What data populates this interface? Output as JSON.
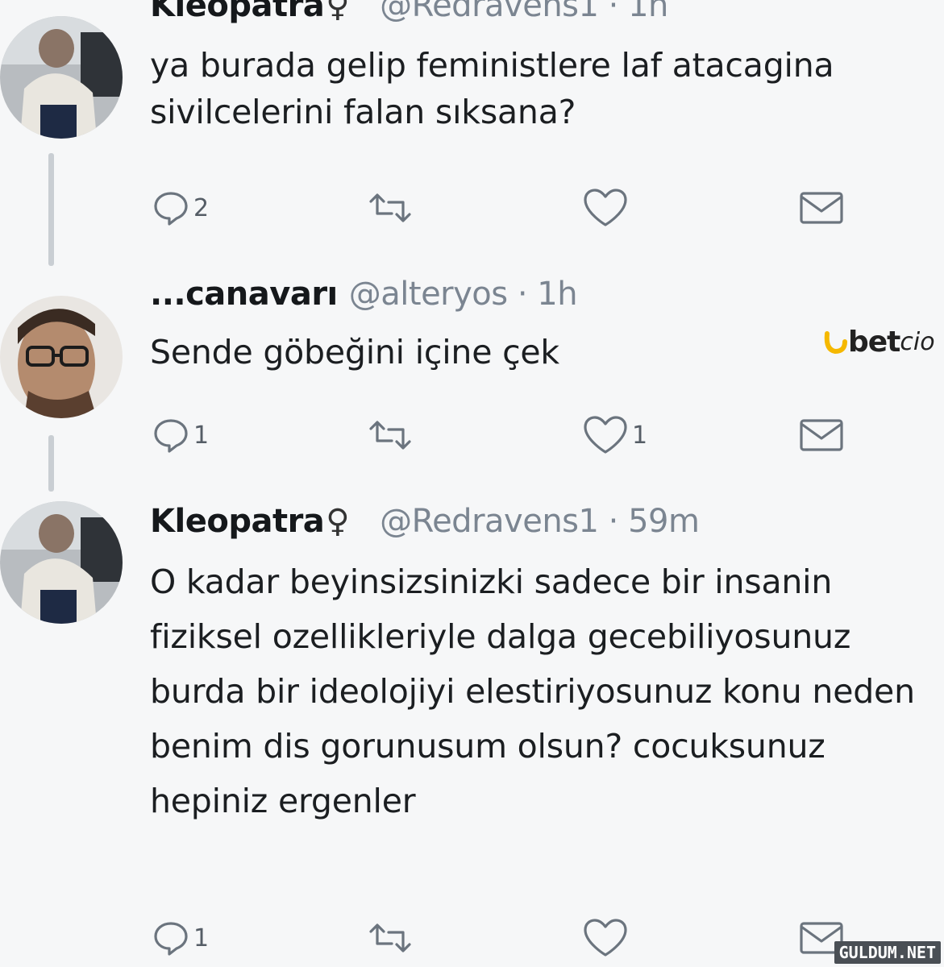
{
  "tweets": [
    {
      "name": "Kleopatra",
      "gender_symbol": "♀",
      "handle_time": "@Redravens1 · 1h",
      "text": "ya burada gelip feministlere laf atacagina sivilcelerini falan sıksana?",
      "reply_count": "2",
      "retweet_count": "",
      "like_count": "",
      "icons": [
        "reply-icon",
        "retweet-icon",
        "like-icon",
        "dm-icon"
      ]
    },
    {
      "name": "...canavarı",
      "gender_symbol": "",
      "handle_time": "@alteryos · 1h",
      "text": "Sende göbeğini içine çek",
      "reply_count": "1",
      "retweet_count": "",
      "like_count": "1",
      "icons": [
        "reply-icon",
        "retweet-icon",
        "like-icon",
        "dm-icon"
      ]
    },
    {
      "name": "Kleopatra",
      "gender_symbol": "♀",
      "handle_time": "@Redravens1 · 59m",
      "text": "O kadar beyinsizsinizki sadece bir insanin fiziksel ozellikleriyle dalga gecebiliyosunuz burda bir ideolojiyi elestiriyosunuz konu neden benim dis gorunusum olsun? cocuksunuz hepiniz ergenler",
      "reply_count": "1",
      "retweet_count": "",
      "like_count": "",
      "icons": [
        "reply-icon",
        "retweet-icon",
        "like-icon",
        "dm-icon"
      ]
    }
  ],
  "overlay": {
    "brand_prefix": "bet",
    "brand_suffix": "cio",
    "watermark": "GULDUM.NET"
  },
  "colors": {
    "background": "#f6f7f8",
    "text": "#15181b",
    "meta": "#7b8591",
    "icon": "#6b747e",
    "brand_accent": "#f5b800"
  }
}
